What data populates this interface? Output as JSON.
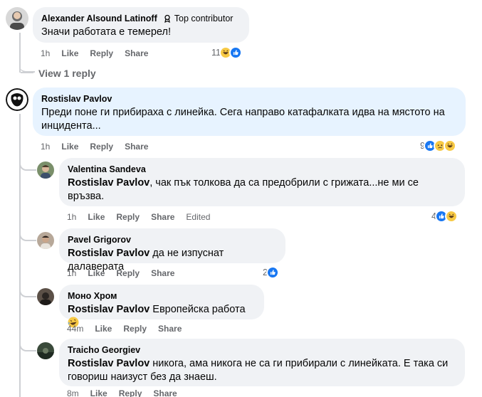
{
  "comments": [
    {
      "author": "Alexander Alsound Latinoff",
      "badge": "Top contributor",
      "text": "Значи работата е темерел!",
      "time": "1h",
      "like": "Like",
      "reply": "Reply",
      "share": "Share",
      "reaction_count": "11",
      "reactions": [
        "haha-icon",
        "like-icon"
      ]
    },
    {
      "author": "Rostislav Pavlov",
      "text": "Преди поне ги прибираха с линейка. Сега направо катафалката идва на мястото на инцидента...",
      "time": "1h",
      "like": "Like",
      "reply": "Reply",
      "share": "Share",
      "reaction_count": "9",
      "reactions": [
        "like-icon",
        "sad-icon",
        "haha-icon"
      ]
    },
    {
      "author": "Valentina Sandeva",
      "mention": "Rostislav Pavlov",
      "text": ", чак пък толкова да са предобрили с грижата...не ми се връзва.",
      "time": "1h",
      "like": "Like",
      "reply": "Reply",
      "share": "Share",
      "edited": "Edited",
      "reaction_count": "4",
      "reactions": [
        "like-icon",
        "haha-icon"
      ]
    },
    {
      "author": "Pavel Grigorov",
      "mention": "Rostislav Pavlov",
      "text": " да не изпуснат далаверата",
      "time": "1h",
      "like": "Like",
      "reply": "Reply",
      "share": "Share",
      "reaction_count": "2",
      "reactions": [
        "like-icon"
      ]
    },
    {
      "author": "Моно Хром",
      "mention": "Rostislav Pavlov",
      "text": " Европейска работа ",
      "time": "44m",
      "like": "Like",
      "reply": "Reply",
      "share": "Share"
    },
    {
      "author": "Traicho Georgiev",
      "mention": "Rostislav Pavlov",
      "text": " никога, ама никога не са ги прибирали с линейката. Е така си говориш наизуст без да знаеш.",
      "time": "8m",
      "like": "Like",
      "reply": "Reply",
      "share": "Share"
    }
  ],
  "view_replies": "View 1 reply",
  "colors": {
    "bubble": "#f0f2f5",
    "bubble_highlight": "#e7f3ff",
    "meta": "#65676b",
    "like_blue": "#1877f2",
    "emoji_yellow": "#f7c944"
  }
}
